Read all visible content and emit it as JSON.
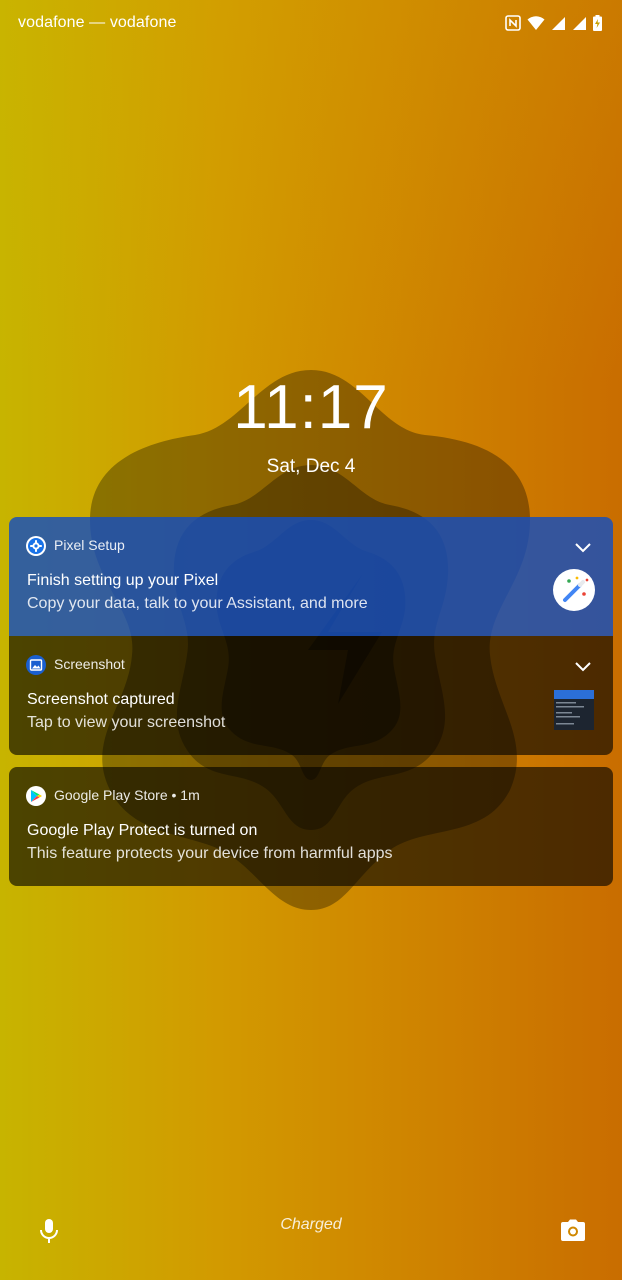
{
  "status_bar": {
    "carrier": "vodafone — vodafone",
    "icons": [
      "nfc-icon",
      "wifi-icon",
      "cell-signal-icon",
      "cell-signal-icon",
      "battery-charging-icon"
    ]
  },
  "lockscreen": {
    "time": "11:17",
    "date": "Sat, Dec 4"
  },
  "notifications": [
    {
      "app": "Pixel Setup",
      "title": "Finish setting up your Pixel",
      "text": "Copy your data, talk to your Assistant, and more",
      "icon": "gear-icon",
      "large_icon": "magic-wand-icon"
    },
    {
      "app": "Screenshot",
      "title": "Screenshot captured",
      "text": "Tap to view your screenshot",
      "icon": "image-icon"
    },
    {
      "app": "Google Play Store • 1m",
      "title": "Google Play Protect is turned on",
      "text": "This feature protects your device from harmful apps",
      "icon": "play-store-icon"
    }
  ],
  "bottom": {
    "status": "Charged",
    "left_icon": "microphone-icon",
    "right_icon": "camera-icon"
  },
  "colors": {
    "accent_blue": "#144ebe",
    "background_yellow": "#c7b400",
    "background_orange": "#c96d00"
  }
}
